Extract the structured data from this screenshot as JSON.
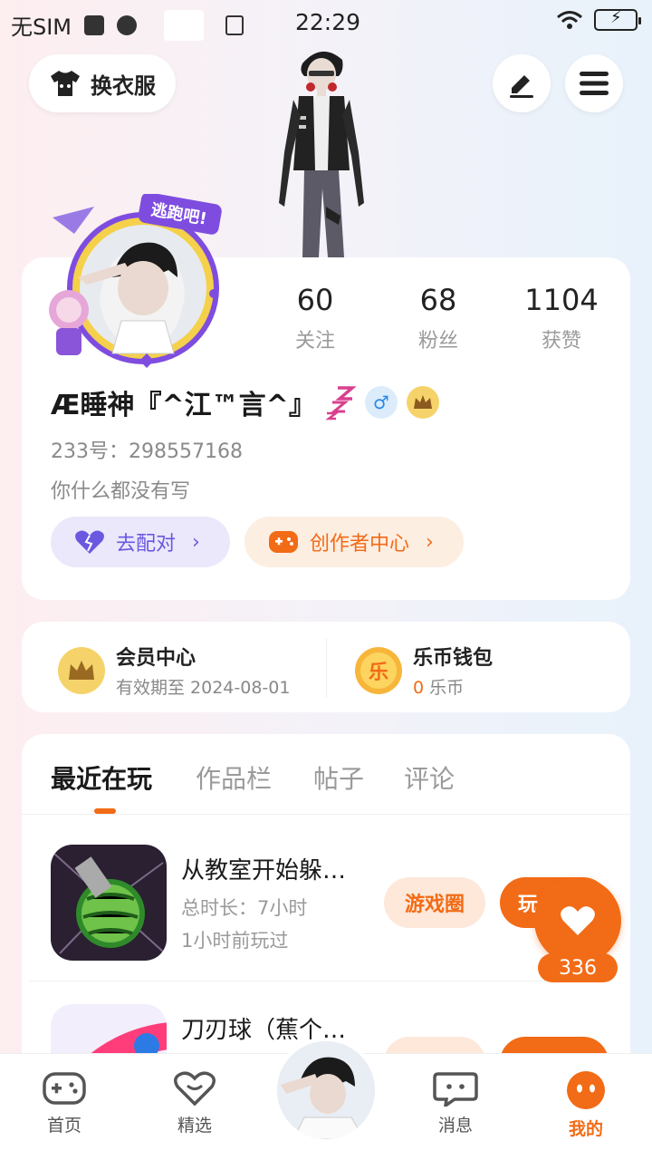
{
  "status_bar": {
    "carrier": "无SIM",
    "time": "22:29"
  },
  "header": {
    "outfit_label": "换衣服",
    "icons": [
      "tshirt-icon",
      "edit-icon",
      "menu-icon"
    ]
  },
  "profile": {
    "frame_badge": "逃跑吧!",
    "nickname": "Æ睡神『^江™言^』",
    "uid_label": "233号：",
    "uid": "298557168",
    "bio": "你什么都没有写",
    "stats": [
      {
        "value": "60",
        "label": "关注"
      },
      {
        "value": "68",
        "label": "粉丝"
      },
      {
        "value": "1104",
        "label": "获赞"
      }
    ],
    "match_button": "去配对",
    "creator_button": "创作者中心"
  },
  "vip": {
    "member_title": "会员中心",
    "member_sub": "有效期至 2024-08-01",
    "wallet_title": "乐币钱包",
    "wallet_amount": "0",
    "wallet_unit": "乐币",
    "coin_glyph": "乐"
  },
  "tabs": [
    "最近在玩",
    "作品栏",
    "帖子",
    "评论"
  ],
  "games": [
    {
      "title": "从教室开始躲…",
      "duration": "总时长：7小时",
      "last_played": "1小时前玩过",
      "circle_button": "游戏圈",
      "play_button": "玩"
    },
    {
      "title": "刀刃球（蕉个…"
    }
  ],
  "floating_like": {
    "count": "336"
  },
  "bottom_nav": [
    {
      "label": "首页"
    },
    {
      "label": "精选"
    },
    {
      "label": "消息"
    },
    {
      "label": "我的"
    }
  ],
  "colors": {
    "accent": "#f26b16",
    "purple": "#6a58e0",
    "gold": "#f5c74a"
  }
}
